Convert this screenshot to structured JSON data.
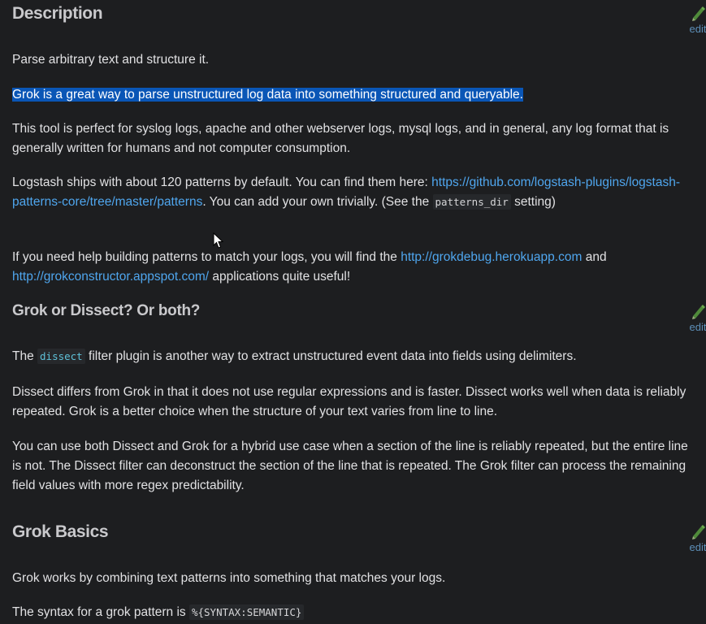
{
  "edit_label": "edit",
  "description": {
    "heading": "Description",
    "p1": "Parse arbitrary text and structure it.",
    "p2_selected": "Grok is a great way to parse unstructured log data into something structured and queryable.",
    "p3": "This tool is perfect for syslog logs, apache and other webserver logs, mysql logs, and in general, any log format that is generally written for humans and not computer consumption.",
    "p4_before": "Logstash ships with about 120 patterns by default. You can find them here: ",
    "p4_link": "https://github.com/logstash-plugins/logstash-patterns-core/tree/master/patterns",
    "p4_mid": ". You can add your own trivially. (See the ",
    "p4_code": "patterns_dir",
    "p4_after": " setting)",
    "p5_before": "If you need help building patterns to match your logs, you will find the ",
    "p5_link1": "http://grokdebug.herokuapp.com",
    "p5_mid": " and ",
    "p5_link2": "http://grokconstructor.appspot.com/",
    "p5_after": " applications quite useful!"
  },
  "dissect": {
    "heading": "Grok or Dissect? Or both?",
    "p1_before": "The ",
    "p1_code": "dissect",
    "p1_after": " filter plugin is another way to extract unstructured event data into fields using delimiters.",
    "p2": "Dissect differs from Grok in that it does not use regular expressions and is faster. Dissect works well when data is reliably repeated. Grok is a better choice when the structure of your text varies from line to line.",
    "p3": "You can use both Dissect and Grok for a hybrid use case when a section of the line is reliably repeated, but the entire line is not. The Dissect filter can deconstruct the section of the line that is repeated. The Grok filter can process the remaining field values with more regex predictability."
  },
  "basics": {
    "heading": "Grok Basics",
    "p1": "Grok works by combining text patterns into something that matches your logs.",
    "p2_before": "The syntax for a grok pattern is ",
    "p2_code": "%{SYNTAX:SEMANTIC}"
  }
}
